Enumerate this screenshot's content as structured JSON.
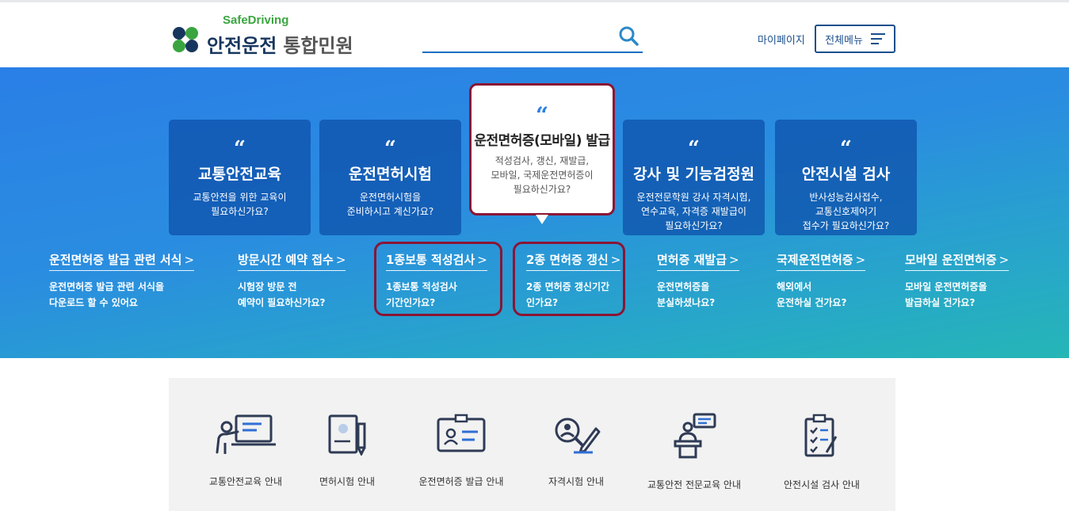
{
  "header": {
    "logo_sub": "SafeDriving",
    "logo_main": "안전운전",
    "logo_light": "통합민원",
    "search_placeholder": "",
    "mypage": "마이페이지",
    "all_menu": "전체메뉴"
  },
  "cards": [
    {
      "title": "교통안전교육",
      "desc": [
        "교통안전을 위한 교육이",
        "필요하신가요?"
      ]
    },
    {
      "title": "운전면허시험",
      "desc": [
        "운전면허시험을",
        "준비하시고 계신가요?"
      ]
    },
    {
      "title": "강사 및 기능검정원",
      "desc": [
        "운전전문학원 강사 자격시험,",
        "연수교육, 자격증 재발급이",
        "필요하신가요?"
      ]
    },
    {
      "title": "안전시설 검사",
      "desc": [
        "반사성능검사접수,",
        "교통신호제어기",
        "접수가 필요하신가요?"
      ]
    }
  ],
  "featured": {
    "title": "운전면허증(모바일) 발급",
    "desc": [
      "적성검사, 갱신, 재발급,",
      "모바일, 국제운전면허증이",
      "필요하신가요?"
    ]
  },
  "quote_mark": "“",
  "arrow": ">",
  "links": [
    {
      "title": "운전면허증 발급 관련 서식",
      "desc": [
        "운전면허증 발급 관련 서식을",
        "다운로드 할 수 있어요"
      ]
    },
    {
      "title": "방문시간 예약 접수",
      "desc": [
        "시험장 방문 전",
        "예약이 필요하신가요?"
      ]
    },
    {
      "title": "1종보통 적성검사",
      "desc": [
        "1종보통 적성검사",
        "기간인가요?"
      ]
    },
    {
      "title": "2종 면허증 갱신",
      "desc": [
        "2종 면허증 갱신기간",
        "인가요?"
      ]
    },
    {
      "title": "면허증 재발급",
      "desc": [
        "운전면허증을",
        "분실하셨나요?"
      ]
    },
    {
      "title": "국제운전면허증",
      "desc": [
        "해외에서",
        "운전하실 건가요?"
      ]
    },
    {
      "title": "모바일 운전면허증",
      "desc": [
        "모바일 운전면허증을",
        "발급하실 건가요?"
      ]
    }
  ],
  "services": [
    {
      "label": "교통안전교육 안내",
      "icon": "lecture-board-icon"
    },
    {
      "label": "면허시험 안내",
      "icon": "document-pen-icon"
    },
    {
      "label": "운전면허증 발급 안내",
      "icon": "id-card-icon"
    },
    {
      "label": "자격시험 안내",
      "icon": "person-search-pen-icon"
    },
    {
      "label": "교통안전 전문교육 안내",
      "icon": "podium-speaker-icon"
    },
    {
      "label": "안전시설 검사 안내",
      "icon": "clipboard-checklist-icon"
    }
  ],
  "colors": {
    "brand_navy": "#17365d",
    "brand_green": "#3aa540",
    "accent_blue": "#1b6ec2",
    "highlight": "#8b1535"
  }
}
